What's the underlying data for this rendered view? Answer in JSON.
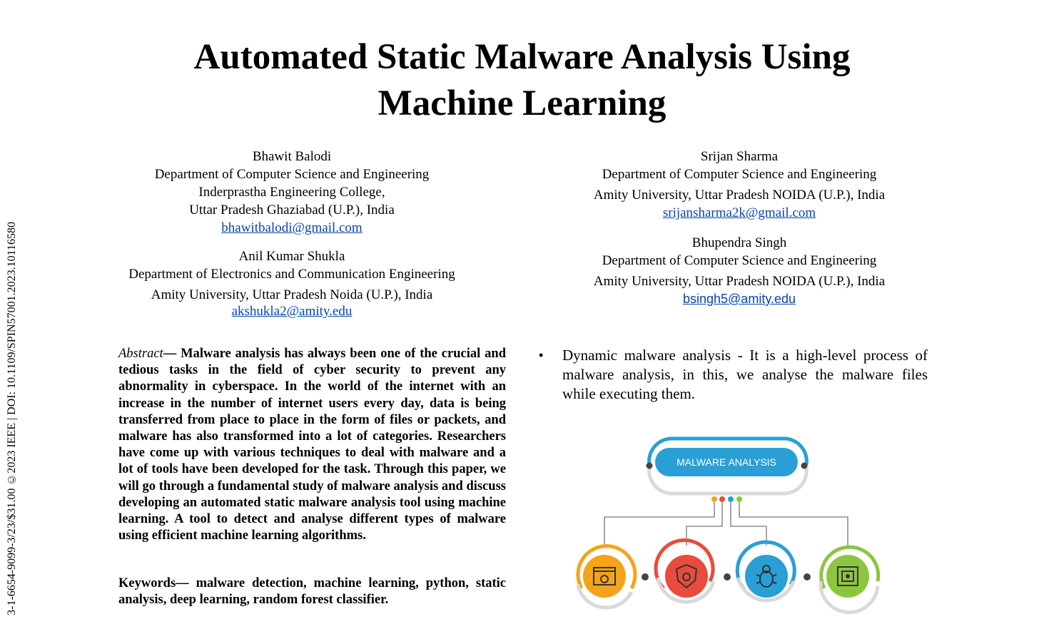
{
  "sidebar_text": "3-1-6654-9099-3/23/$31.00 ©2023 IEEE | DOI: 10.1109/SPIN57001.2023.10116580",
  "title_line1": "Automated Static Malware Analysis Using",
  "title_line2": "Machine Learning",
  "authors": [
    {
      "name": "Bhawit Balodi",
      "lines": [
        "Department of Computer Science and Engineering",
        "Inderprastha Engineering College,",
        "Uttar Pradesh Ghaziabad (U.P.), India"
      ],
      "email": "bhawitbalodi@gmail.com"
    },
    {
      "name": "Anil Kumar Shukla",
      "lines": [
        "Department of Electronics and Communication Engineering",
        "Amity University, Uttar Pradesh Noida (U.P.), India"
      ],
      "email": "akshukla2@amity.edu"
    },
    {
      "name": "Srijan Sharma",
      "lines": [
        "Department of Computer Science and Engineering",
        "Amity University, Uttar Pradesh NOIDA (U.P.), India"
      ],
      "email": "srijansharma2k@gmail.com"
    },
    {
      "name": "Bhupendra Singh",
      "lines": [
        "Department of Computer Science and Engineering",
        "Amity University, Uttar Pradesh NOIDA (U.P.), India"
      ],
      "email": "bsingh5@amity.edu"
    }
  ],
  "abstract_label": "Abstract",
  "abstract_text": "— Malware analysis has always been one of the crucial and tedious tasks in the field of cyber security to prevent any abnormality in cyberspace. In the world of the internet with an increase in the number of internet users every day, data is being transferred from place to place in the form of files or packets, and malware has also transformed into a lot of categories. Researchers have come up with various techniques to deal with malware and a lot of tools have been developed for the task. Through this paper, we will go through a fundamental study of malware analysis and discuss developing an automated static malware analysis tool using machine learning. A tool to detect and analyse different types of malware using efficient machine learning algorithms.",
  "keywords_label": "Keywords",
  "keywords_text": "— malware detection, machine learning, python, static analysis, deep learning, random forest classifier.",
  "bullet_symbol": "•",
  "bullet_text": "Dynamic malware analysis - It is a high-level process of malware analysis, in this, we analyse the malware files while executing them.",
  "diagram_label": "MALWARE ANALYSIS",
  "diagram_colors": {
    "banner": "#2a9fd6",
    "orange": "#f5a31a",
    "red": "#e94b3c",
    "blue": "#2a9fd6",
    "green": "#8cc63f"
  }
}
